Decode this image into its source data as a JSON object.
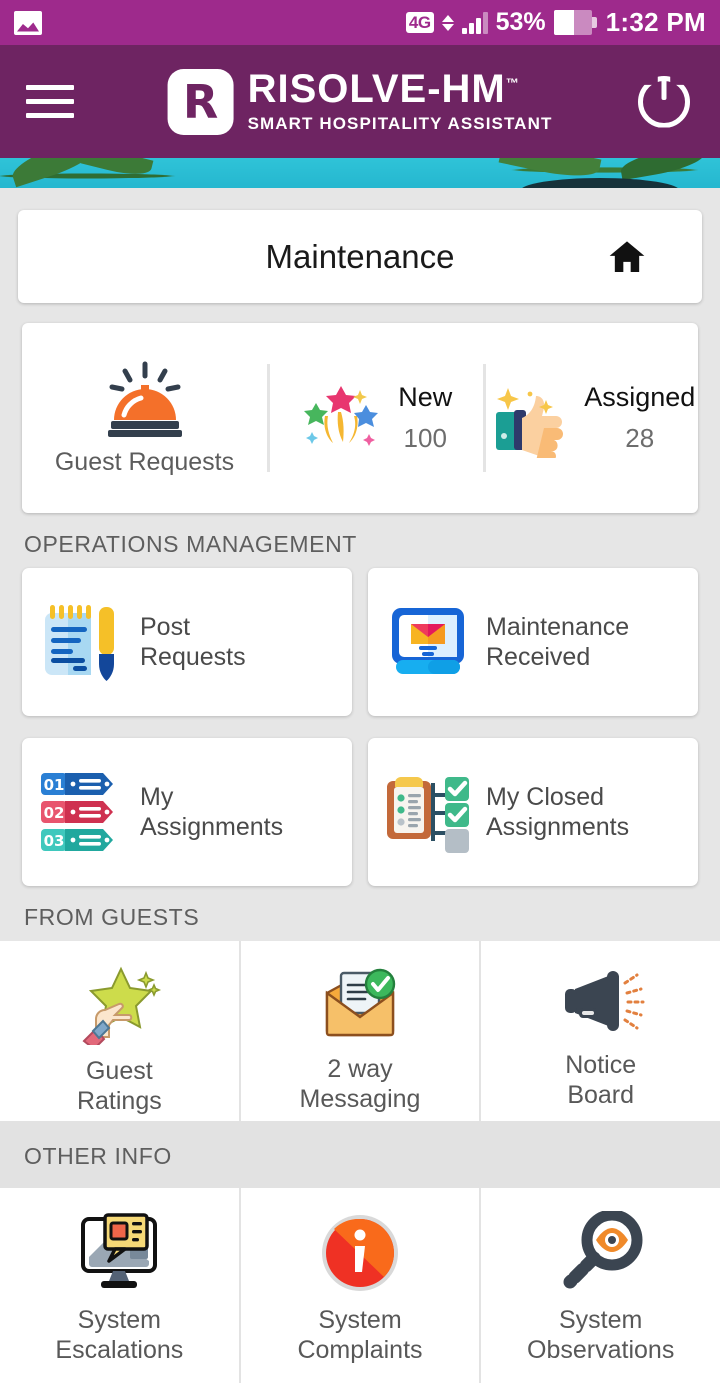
{
  "statusbar": {
    "gallery_icon": "gallery-icon",
    "network": "4G",
    "battery_percent": "53%",
    "battery_level": 53,
    "time": "1:32 PM",
    "signal_icon": "signal-bars-icon",
    "data_arrows_icon": "data-transfer-arrows-icon",
    "battery_icon": "battery-icon"
  },
  "appbar": {
    "menu_icon": "hamburger-menu-icon",
    "logo_letter": "R",
    "brand_name": "RISOLVE-HM",
    "brand_tm": "™",
    "brand_tagline": "SMART HOSPITALITY ASSISTANT",
    "power_icon": "power-button-icon",
    "bg_color": "#6e2462",
    "status_color": "#9e2a8c"
  },
  "title_card": {
    "title": "Maintenance",
    "home_icon": "home-icon"
  },
  "stats": {
    "guest_requests": {
      "label": "Guest Requests",
      "icon": "service-bell-icon"
    },
    "items": [
      {
        "name": "New",
        "value": "100",
        "icon": "fireworks-stars-icon"
      },
      {
        "name": "Assigned",
        "value": "28",
        "icon": "thumbs-up-icon"
      }
    ]
  },
  "sections": [
    {
      "heading": "OPERATIONS MANAGEMENT",
      "layout": "grid2",
      "tiles": [
        {
          "label": "Post\nRequests",
          "line1": "Post",
          "line2": "Requests",
          "icon": "notepad-pen-icon"
        },
        {
          "label": "Maintenance\nReceived",
          "line1": "Maintenance",
          "line2": "Received",
          "icon": "monitor-envelope-icon"
        },
        {
          "label": "My\nAssignments",
          "line1": "My",
          "line2": "Assignments",
          "icon": "numbered-tags-icon"
        },
        {
          "label": "My Closed\nAssignments",
          "line1": "My Closed",
          "line2": "Assignments",
          "icon": "clipboard-checks-icon"
        }
      ]
    },
    {
      "heading": "FROM GUESTS",
      "layout": "grid3",
      "tiles": [
        {
          "line1": "Guest",
          "line2": "Ratings",
          "icon": "star-rating-hand-icon"
        },
        {
          "line1": "2 way",
          "line2": "Messaging",
          "icon": "envelope-check-icon"
        },
        {
          "line1": "Notice",
          "line2": "Board",
          "icon": "megaphone-icon"
        }
      ]
    },
    {
      "heading": "OTHER INFO",
      "layout": "grid3",
      "tiles": [
        {
          "line1": "System",
          "line2": "Escalations",
          "icon": "monitor-alert-icon"
        },
        {
          "line1": "System",
          "line2": "Complaints",
          "icon": "info-circle-icon"
        },
        {
          "line1": "System",
          "line2": "Observations",
          "icon": "magnifier-eye-icon"
        }
      ]
    }
  ],
  "tag_numbers": [
    "01",
    "02",
    "03"
  ]
}
